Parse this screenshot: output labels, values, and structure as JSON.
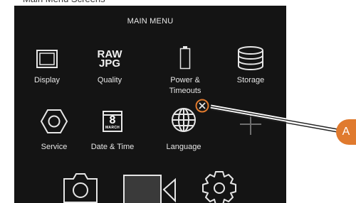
{
  "menu": {
    "title": "MAIN MENU",
    "items": [
      {
        "label": "Display",
        "icon": "display-icon"
      },
      {
        "label": "Quality",
        "icon": "raw-jpg-icon",
        "icon_text_top": "RAW",
        "icon_text_bottom": "JPG"
      },
      {
        "label": "Power & Timeouts",
        "icon": "battery-icon"
      },
      {
        "label": "Storage",
        "icon": "storage-icon"
      },
      {
        "label": "Service",
        "icon": "service-icon"
      },
      {
        "label": "Date & Time",
        "icon": "calendar-icon",
        "icon_day": "8",
        "icon_month": "MARCH"
      },
      {
        "label": "Language",
        "icon": "globe-icon"
      },
      {
        "label": "",
        "icon": "add-icon"
      }
    ],
    "remove_badge_icon": "remove-icon",
    "bottom_bar": [
      "camera-icon",
      "video-icon",
      "settings-icon"
    ]
  },
  "callout": {
    "label": "A",
    "color": "#e07a2e"
  },
  "colors": {
    "screen_bg": "#141414",
    "foreground": "#e6e6e6",
    "add_icon": "#6e6e6e"
  }
}
